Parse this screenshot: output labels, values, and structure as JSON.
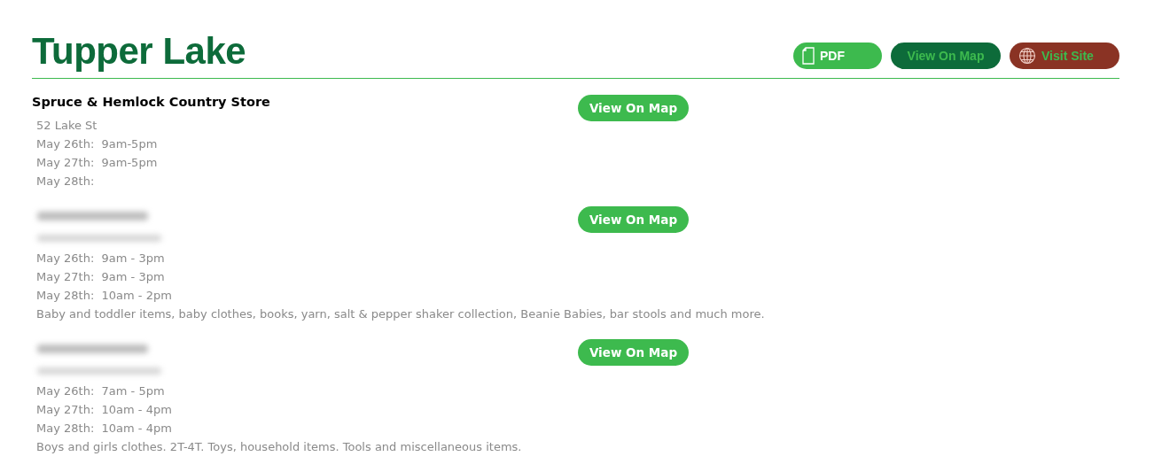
{
  "title": "Tupper Lake",
  "header_buttons": [
    {
      "kind": "pdf",
      "label": "PDF"
    },
    {
      "kind": "map",
      "label": "View On Map"
    },
    {
      "kind": "site",
      "label": "Visit Site"
    }
  ],
  "listings": [
    {
      "name": "Spruce & Hemlock Country Store",
      "address": "52 Lake St",
      "hours": [
        "May 26th:  9am-5pm",
        "May 27th:  9am-5pm",
        "May 28th:"
      ],
      "button": "View On Map"
    },
    {
      "name_redacted": true,
      "address_redacted": true,
      "hours": [
        "May 26th:  9am - 3pm",
        "May 27th:  9am - 3pm",
        "May 28th:  10am - 2pm"
      ],
      "description": "Baby and toddler items, baby clothes, books, yarn, salt & pepper shaker collection, Beanie Babies, bar stools and much more.",
      "button": "View On Map"
    },
    {
      "name_redacted": true,
      "address_redacted": true,
      "hours": [
        "May 26th:  7am - 5pm",
        "May 27th:  10am - 4pm",
        "May 28th:  10am - 4pm"
      ],
      "description": "Boys and girls clothes. 2T-4T. Toys, household items. Tools and miscellaneous items.",
      "button": "View On Map"
    }
  ]
}
